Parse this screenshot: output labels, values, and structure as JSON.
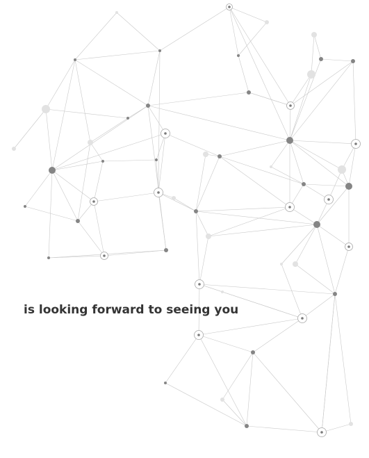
{
  "headline": "is looking forward to seeing you",
  "colors": {
    "background": "#ffffff",
    "text": "#343434",
    "line": "#c8c8c8",
    "node_dark": "#808080",
    "node_light": "#e3e3e3"
  }
}
